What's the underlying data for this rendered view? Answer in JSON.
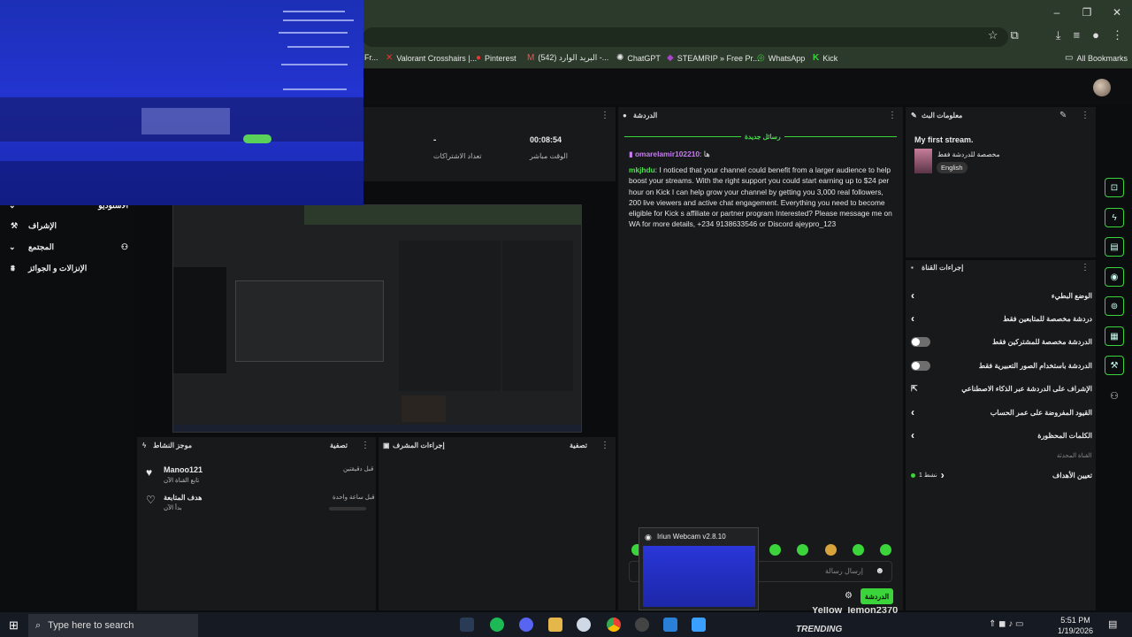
{
  "browser": {
    "window_controls": [
      "–",
      "❐",
      "✕"
    ],
    "bookmarks": [
      {
        "label": "Fr...",
        "icon": "bookmark-icon"
      },
      {
        "label": "Valorant Crosshairs |...",
        "icon": "crosshair-icon"
      },
      {
        "label": "Pinterest",
        "icon": "pinterest-icon"
      },
      {
        "label": "(542) البريد الوارد -...",
        "icon": "gmail-icon"
      },
      {
        "label": "ChatGPT",
        "icon": "chatgpt-icon"
      },
      {
        "label": "STEAMRIP » Free Pr...",
        "icon": "steamrip-icon"
      },
      {
        "label": "WhatsApp",
        "icon": "whatsapp-icon"
      },
      {
        "label": "Kick",
        "icon": "kick-icon"
      }
    ],
    "all_bookmarks": "All Bookmarks"
  },
  "sidebar": {
    "items": [
      {
        "label": "الاستوديو"
      },
      {
        "label": "الإشراف"
      },
      {
        "label": "المجتمع"
      },
      {
        "label": "الإنزالات و الجوائز"
      }
    ]
  },
  "stats": {
    "subs_value": "-",
    "subs_label": "تعداد الاشتراكات",
    "live_value": "00:08:54",
    "live_label": "الوقت مباشر"
  },
  "activity": {
    "title": "موجز النشاط",
    "filter": "تصفية",
    "items": [
      {
        "name": "Manoo121",
        "desc": "تابع القناة الآن",
        "time": "قبل دقيقتين"
      },
      {
        "name": "هدف المتابعة",
        "desc": "بدأ الآن",
        "time": "قبل ساعة واحدة"
      }
    ]
  },
  "mod": {
    "title": "إجراءات المشرف",
    "filter": "تصفية"
  },
  "chat": {
    "title": "الدردشة",
    "new_messages": "رسائل جديدة",
    "messages": [
      {
        "user": "omarelamir102210",
        "text": "ها"
      },
      {
        "user": "mkjhdu",
        "text": "I noticed that your channel could benefit from a larger audience to help boost your streams. With the right support you could start earning up to $24 per hour on Kick I can help grow your channel by getting you 3,000 real followers, 200 live viewers and active chat engagement. Everything you need to become eligible for Kick s affiliate or partner program Interested? Please message me on WA for more details, +234 9138633546 or Discord ajeypro_123"
      }
    ],
    "input_placeholder": "إرسال رسالة",
    "send_label": "الدردشة"
  },
  "stream_info": {
    "title": "معلومات البث",
    "stream_title": "My first stream.",
    "category": "مخصصة للدردشة فقط",
    "language": "English"
  },
  "channel_actions": {
    "title": "إجراءات القناة",
    "rows": [
      {
        "label": "الوضع البطيء",
        "control": "chevron"
      },
      {
        "label": "دردشة مخصصة للمتابعين فقط",
        "control": "chevron"
      },
      {
        "label": "الدردشة مخصصة للمشتركين فقط",
        "control": "toggle"
      },
      {
        "label": "الدردشة باستخدام الصور التعبيرية فقط",
        "control": "toggle"
      },
      {
        "label": "الإشراف على الدردشة عبر الذكاء الاصطناعي",
        "control": "external"
      },
      {
        "label": "القيود المفروضة على عمر الحساب",
        "control": "chevron"
      },
      {
        "label": "الكلمات المحظورة",
        "control": "chevron"
      }
    ],
    "section_label": "القناة المحدثة",
    "goals_label": "تعيين الأهداف",
    "goals_status": "نشط 1"
  },
  "popup": {
    "title": "Iriun Webcam v2.8.10"
  },
  "taskbar": {
    "search_placeholder": "Type here to search",
    "time": "5:51 PM",
    "date": "1/19/2026",
    "trending": "TRENDING",
    "tray_text": "Yellow_lemon2370"
  },
  "colors": {
    "accent": "#3bd43b",
    "chrome": "#2b3a2a",
    "panel": "#17191b"
  }
}
